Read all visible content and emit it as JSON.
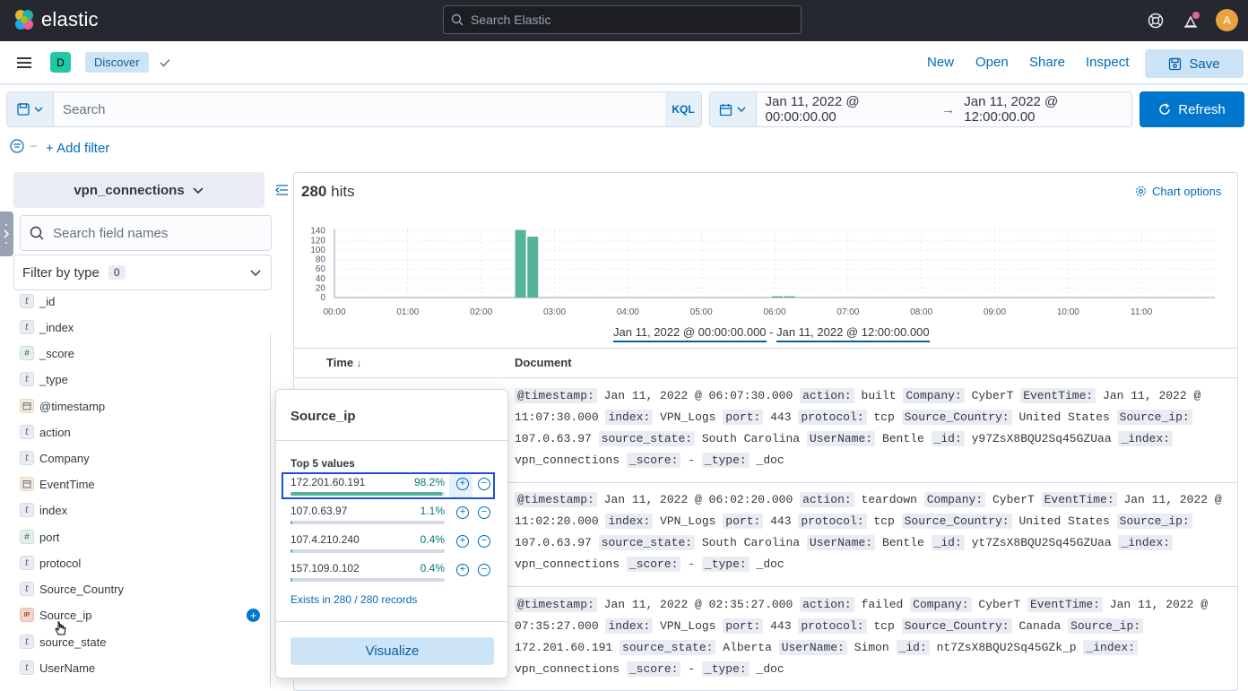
{
  "header": {
    "logo_text": "elastic",
    "search_placeholder": "Search Elastic",
    "avatar_initial": "A",
    "notification_color": "#e9609a"
  },
  "appbar": {
    "space_initial": "D",
    "breadcrumb": "Discover",
    "links": {
      "new": "New",
      "open": "Open",
      "share": "Share",
      "inspect": "Inspect"
    },
    "save_label": "Save"
  },
  "query": {
    "placeholder": "Search",
    "language": "KQL",
    "date_start": "Jan 11, 2022 @ 00:00:00.00",
    "date_arrow": "→",
    "date_end": "Jan 11, 2022 @ 12:00:00.00",
    "refresh_label": "Refresh",
    "add_filter": "+ Add filter"
  },
  "sidebar": {
    "index_pattern": "vpn_connections",
    "field_search_placeholder": "Search field names",
    "filter_by_type": "Filter by type",
    "filter_count": "0",
    "fields": [
      {
        "type": "t",
        "name": "_id"
      },
      {
        "type": "t",
        "name": "_index"
      },
      {
        "type": "#",
        "name": "_score"
      },
      {
        "type": "t",
        "name": "_type"
      },
      {
        "type": "date",
        "name": "@timestamp"
      },
      {
        "type": "t",
        "name": "action"
      },
      {
        "type": "t",
        "name": "Company"
      },
      {
        "type": "date",
        "name": "EventTime"
      },
      {
        "type": "t",
        "name": "index"
      },
      {
        "type": "#",
        "name": "port"
      },
      {
        "type": "t",
        "name": "protocol"
      },
      {
        "type": "t",
        "name": "Source_Country"
      },
      {
        "type": "IP",
        "name": "Source_ip"
      },
      {
        "type": "t",
        "name": "source_state"
      },
      {
        "type": "t",
        "name": "UserName"
      }
    ]
  },
  "main": {
    "hits_count": "280",
    "hits_label": "hits",
    "chart_options": "Chart options",
    "range_start": "Jan 11, 2022 @ 00:00:00.000",
    "range_sep": " - ",
    "range_end": "Jan 11, 2022 @ 12:00:00.000",
    "col_time": "Time",
    "col_document": "Document"
  },
  "chart_data": {
    "type": "bar",
    "x": [
      "00:00",
      "01:00",
      "02:00",
      "03:00",
      "04:00",
      "05:00",
      "06:00",
      "07:00",
      "08:00",
      "09:00",
      "10:00",
      "11:00"
    ],
    "bars": [
      {
        "time": "02:30",
        "value": 142
      },
      {
        "time": "02:40",
        "value": 128
      },
      {
        "time": "06:00",
        "value": 2
      },
      {
        "time": "06:10",
        "value": 2
      }
    ],
    "yticks": [
      0,
      20,
      40,
      60,
      80,
      100,
      120,
      140
    ],
    "ylim": [
      0,
      145
    ],
    "bar_color": "#54b399"
  },
  "documents": [
    [
      [
        "@timestamp:",
        "Jan 11, 2022 @ 06:07:30.000"
      ],
      [
        "action:",
        "built"
      ],
      [
        "Company:",
        "CyberT"
      ],
      [
        "EventTime:",
        "Jan 11, 2022 @ 11:07:30.000"
      ],
      [
        "index:",
        "VPN_Logs"
      ],
      [
        "port:",
        "443"
      ],
      [
        "protocol:",
        "tcp"
      ],
      [
        "Source_Country:",
        "United States"
      ],
      [
        "Source_ip:",
        "107.0.63.97"
      ],
      [
        "source_state:",
        "South Carolina"
      ],
      [
        "UserName:",
        "Bentle"
      ],
      [
        "_id:",
        "y97ZsX8BQU2Sq45GZUaa"
      ],
      [
        "_index:",
        "vpn_connections"
      ],
      [
        "_score:",
        "-"
      ],
      [
        "_type:",
        "_doc"
      ]
    ],
    [
      [
        "@timestamp:",
        "Jan 11, 2022 @ 06:02:20.000"
      ],
      [
        "action:",
        "teardown"
      ],
      [
        "Company:",
        "CyberT"
      ],
      [
        "EventTime:",
        "Jan 11, 2022 @ 11:02:20.000"
      ],
      [
        "index:",
        "VPN_Logs"
      ],
      [
        "port:",
        "443"
      ],
      [
        "protocol:",
        "tcp"
      ],
      [
        "Source_Country:",
        "United States"
      ],
      [
        "Source_ip:",
        "107.0.63.97"
      ],
      [
        "source_state:",
        "South Carolina"
      ],
      [
        "UserName:",
        "Bentle"
      ],
      [
        "_id:",
        "yt7ZsX8BQU2Sq45GZUaa"
      ],
      [
        "_index:",
        "vpn_connections"
      ],
      [
        "_score:",
        "-"
      ],
      [
        "_type:",
        "_doc"
      ]
    ],
    [
      [
        "@timestamp:",
        "Jan 11, 2022 @ 02:35:27.000"
      ],
      [
        "action:",
        "failed"
      ],
      [
        "Company:",
        "CyberT"
      ],
      [
        "EventTime:",
        "Jan 11, 2022 @ 07:35:27.000"
      ],
      [
        "index:",
        "VPN_Logs"
      ],
      [
        "port:",
        "443"
      ],
      [
        "protocol:",
        "tcp"
      ],
      [
        "Source_Country:",
        "Canada"
      ],
      [
        "Source_ip:",
        "172.201.60.191"
      ],
      [
        "source_state:",
        "Alberta"
      ],
      [
        "UserName:",
        "Simon"
      ],
      [
        "_id:",
        "nt7ZsX8BQU2Sq45GZk_p"
      ],
      [
        "_index:",
        "vpn_connections"
      ],
      [
        "_score:",
        "-"
      ],
      [
        "_type:",
        "_doc"
      ]
    ]
  ],
  "popover": {
    "title": "Source_ip",
    "top_label": "Top 5 values",
    "values": [
      {
        "value": "172.201.60.191",
        "percent": "98.2%",
        "fraction": 0.982
      },
      {
        "value": "107.0.63.97",
        "percent": "1.1%",
        "fraction": 0.011
      },
      {
        "value": "107.4.210.240",
        "percent": "0.4%",
        "fraction": 0.004
      },
      {
        "value": "157.109.0.102",
        "percent": "0.4%",
        "fraction": 0.004
      }
    ],
    "exists": "Exists in 280 / 280 records",
    "visualize_label": "Visualize"
  }
}
